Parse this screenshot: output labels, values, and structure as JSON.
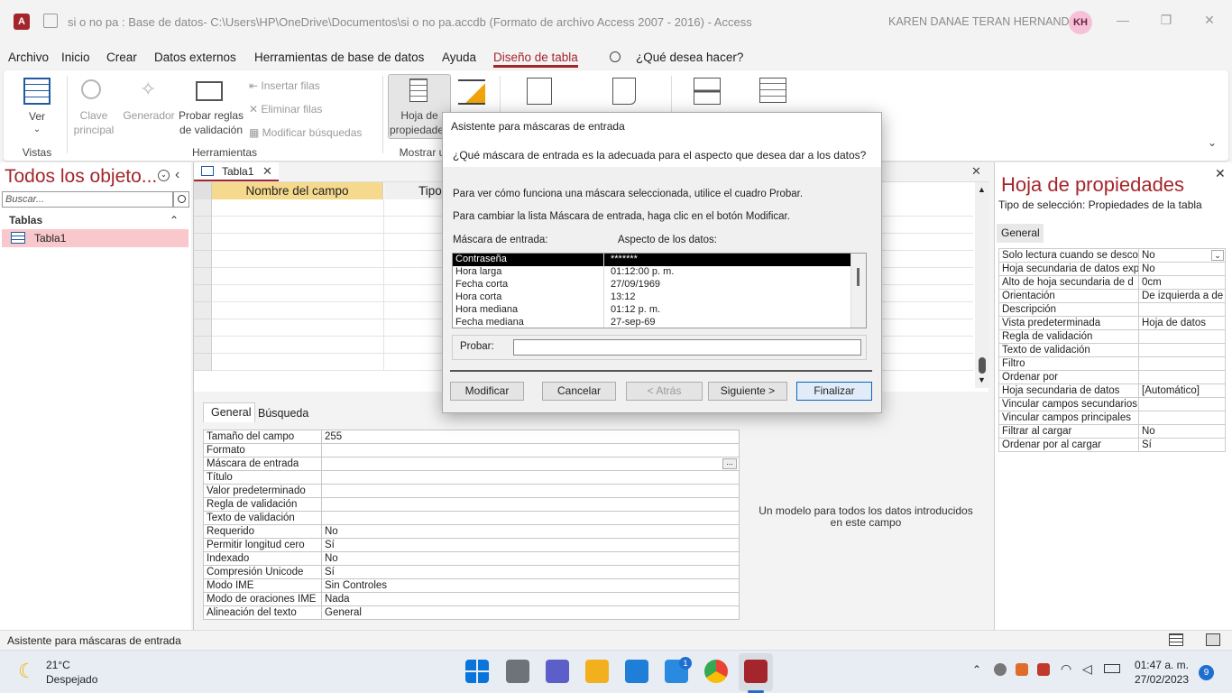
{
  "window": {
    "title": "si o no pa : Base de datos- C:\\Users\\HP\\OneDrive\\Documentos\\si o no pa.accdb (Formato de archivo Access 2007 - 2016)  -  Access",
    "user_name": "KAREN DANAE TERAN HERNANDEZ",
    "user_initials": "KH",
    "minimize_glyph": "—",
    "restore_glyph": "❐",
    "close_glyph": "✕"
  },
  "menu": {
    "items": [
      "Archivo",
      "Inicio",
      "Crear",
      "Datos externos",
      "Herramientas de base de datos",
      "Ayuda",
      "Diseño de tabla"
    ],
    "active": "Diseño de tabla",
    "search": "¿Qué desea hacer?"
  },
  "ribbon": {
    "ver": "Ver",
    "clave": "Clave principal",
    "generador": "Generador",
    "probar": "Probar reglas de validación",
    "insertar": "Insertar filas",
    "eliminar": "Eliminar filas",
    "modificar": "Modificar búsquedas",
    "hoja": "Hoja de propiedades",
    "group_vistas": "Vistas",
    "group_herramientas": "Herramientas",
    "group_mostrar": "Mostrar u"
  },
  "nav": {
    "title": "Todos los objeto...",
    "search_placeholder": "Buscar...",
    "section": "Tablas",
    "item": "Tabla1"
  },
  "doc": {
    "tab": "Tabla1",
    "col_name": "Nombre del campo",
    "col_type": "Tipo",
    "tabs": [
      "General",
      "Búsqueda"
    ],
    "field_props": [
      {
        "k": "Tamaño del campo",
        "v": "255"
      },
      {
        "k": "Formato",
        "v": ""
      },
      {
        "k": "Máscara de entrada",
        "v": ""
      },
      {
        "k": "Título",
        "v": ""
      },
      {
        "k": "Valor predeterminado",
        "v": ""
      },
      {
        "k": "Regla de validación",
        "v": ""
      },
      {
        "k": "Texto de validación",
        "v": ""
      },
      {
        "k": "Requerido",
        "v": "No"
      },
      {
        "k": "Permitir longitud cero",
        "v": "Sí"
      },
      {
        "k": "Indexado",
        "v": "No"
      },
      {
        "k": "Compresión Unicode",
        "v": "Sí"
      },
      {
        "k": "Modo IME",
        "v": "Sin Controles"
      },
      {
        "k": "Modo de oraciones IME",
        "v": "Nada"
      },
      {
        "k": "Alineación del texto",
        "v": "General"
      }
    ],
    "ellipsis": "...",
    "description": "Un modelo para todos los datos introducidos en este campo"
  },
  "props": {
    "title": "Hoja de propiedades",
    "selection_type": "Tipo de selección:  Propiedades de la tabla",
    "tab": "General",
    "rows": [
      {
        "k": "Solo lectura cuando se desco",
        "v": "No"
      },
      {
        "k": "Hoja secundaria de datos exp",
        "v": "No"
      },
      {
        "k": "Alto de hoja secundaria de d",
        "v": "0cm"
      },
      {
        "k": "Orientación",
        "v": "De izquierda a de"
      },
      {
        "k": "Descripción",
        "v": ""
      },
      {
        "k": "Vista predeterminada",
        "v": "Hoja de datos"
      },
      {
        "k": "Regla de validación",
        "v": ""
      },
      {
        "k": "Texto de validación",
        "v": ""
      },
      {
        "k": "Filtro",
        "v": ""
      },
      {
        "k": "Ordenar por",
        "v": ""
      },
      {
        "k": "Hoja secundaria de datos",
        "v": "[Automático]"
      },
      {
        "k": "Vincular campos secundarios",
        "v": ""
      },
      {
        "k": "Vincular campos principales",
        "v": ""
      },
      {
        "k": "Filtrar al cargar",
        "v": "No"
      },
      {
        "k": "Ordenar por al cargar",
        "v": "Sí"
      }
    ]
  },
  "status": "Asistente para máscaras de entrada",
  "taskbar": {
    "temp": "21°C",
    "weather": "Despejado",
    "time": "01:47 a. m.",
    "date": "27/02/2023",
    "notif": "9",
    "mail_badge": "1"
  },
  "dialog": {
    "title": "Asistente para máscaras de entrada",
    "question": "¿Qué máscara de entrada es la adecuada para el aspecto que desea dar a los datos?",
    "line1": "Para ver cómo funciona una máscara seleccionada, utilice el cuadro Probar.",
    "line2": "Para cambiar la lista Máscara de entrada, haga clic en el botón Modificar.",
    "col_mask": "Máscara de entrada:",
    "col_look": "Aspecto de los datos:",
    "masks": [
      {
        "name": "Contraseña",
        "look": "*******"
      },
      {
        "name": "Hora larga",
        "look": "01:12:00 p. m."
      },
      {
        "name": "Fecha corta",
        "look": "27/09/1969"
      },
      {
        "name": "Hora corta",
        "look": "13:12"
      },
      {
        "name": "Hora mediana",
        "look": "01:12 p. m."
      },
      {
        "name": "Fecha mediana",
        "look": "27-sep-69"
      }
    ],
    "selected_mask": "Contraseña",
    "probar_label": "Probar:",
    "probar_value": "",
    "buttons": {
      "modificar": "Modificar",
      "cancelar": "Cancelar",
      "atras": "< Atrás",
      "siguiente": "Siguiente >",
      "finalizar": "Finalizar"
    }
  },
  "colors": {
    "accent": "#a4262c",
    "highlight": "#f5d98c",
    "nav_selected": "#f8c8cc"
  }
}
